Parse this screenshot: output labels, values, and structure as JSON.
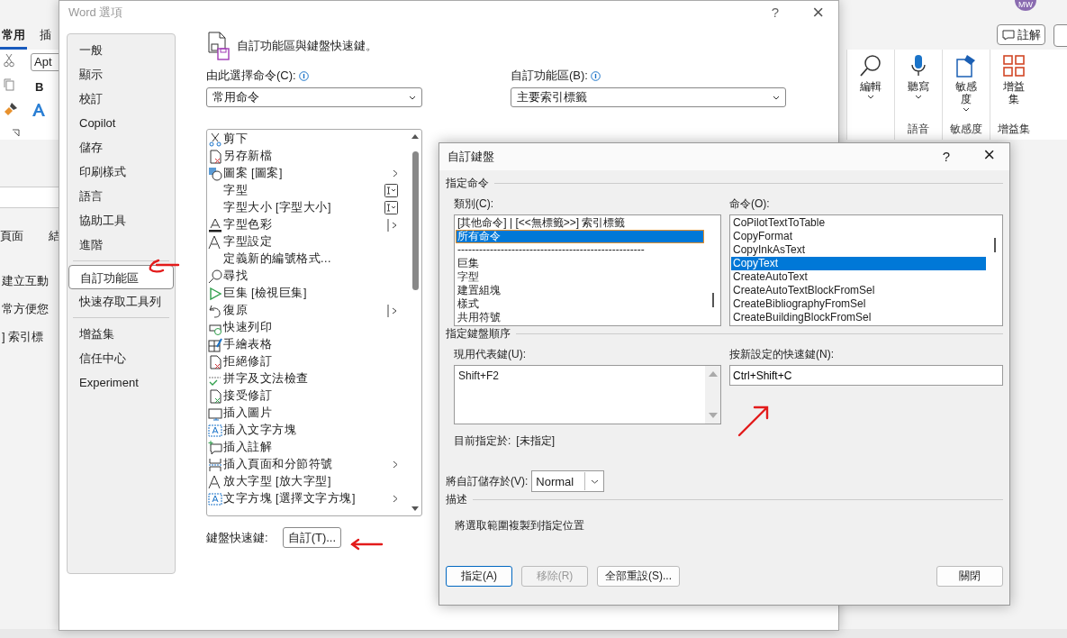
{
  "word": {
    "tabs": [
      {
        "label": "常用",
        "selected": true
      },
      {
        "label": "插",
        "selected": false
      }
    ],
    "font_field": {
      "value": "Apt"
    },
    "bold": "B",
    "ribbon_groups": [
      {
        "buttons": [
          {
            "label": "編輯",
            "dropdown": true
          }
        ]
      },
      {
        "title": "語音",
        "buttons": [
          {
            "label": "聽寫",
            "dropdown": true
          }
        ]
      },
      {
        "title": "敏感度",
        "buttons": [
          {
            "label": "敏感度",
            "dropdown": true
          }
        ]
      },
      {
        "title": "增益集",
        "buttons": [
          {
            "label": "增益集",
            "dropdown": false
          }
        ]
      }
    ],
    "comment_button": "註解",
    "avatar": "MW",
    "doc_tabs": [
      "頁面",
      "結"
    ],
    "doc_lines": [
      "建立互動",
      "常方便您",
      "] 索引標"
    ]
  },
  "options": {
    "title": "Word 選項",
    "help": "?",
    "close": "×",
    "nav_groups": [
      [
        {
          "label": "一般",
          "selected": false
        },
        {
          "label": "顯示",
          "selected": false
        },
        {
          "label": "校訂",
          "selected": false
        },
        {
          "label": "Copilot",
          "selected": false
        },
        {
          "label": "儲存",
          "selected": false
        },
        {
          "label": "印刷樣式",
          "selected": false
        },
        {
          "label": "語言",
          "selected": false
        },
        {
          "label": "協助工具",
          "selected": false
        },
        {
          "label": "進階",
          "selected": false
        }
      ],
      [
        {
          "label": "自訂功能區",
          "selected": true
        },
        {
          "label": "快速存取工具列",
          "selected": false
        }
      ],
      [
        {
          "label": "增益集",
          "selected": false
        },
        {
          "label": "信任中心",
          "selected": false
        },
        {
          "label": "Experiment",
          "selected": false
        }
      ]
    ],
    "heading": "自訂功能區與鍵盤快速鍵。",
    "choose_label": "由此選擇命令(C):",
    "choose_value": "常用命令",
    "ribbon_label": "自訂功能區(B):",
    "ribbon_value": "主要索引標籤",
    "commands": [
      {
        "label": "剪下",
        "icon": true,
        "kind": "none"
      },
      {
        "label": "另存新檔",
        "icon": true,
        "kind": "none"
      },
      {
        "label": "圖案 [圖案]",
        "icon": true,
        "kind": "arrow"
      },
      {
        "label": "字型",
        "icon": false,
        "kind": "field"
      },
      {
        "label": "字型大小 [字型大小]",
        "icon": false,
        "kind": "field"
      },
      {
        "label": "字型色彩",
        "icon": true,
        "kind": "split"
      },
      {
        "label": "字型設定",
        "icon": true,
        "kind": "none"
      },
      {
        "label": "定義新的編號格式...",
        "icon": false,
        "kind": "none"
      },
      {
        "label": "尋找",
        "icon": true,
        "kind": "none"
      },
      {
        "label": "巨集 [檢視巨集]",
        "icon": true,
        "kind": "none"
      },
      {
        "label": "復原",
        "icon": true,
        "kind": "split"
      },
      {
        "label": "快速列印",
        "icon": true,
        "kind": "none"
      },
      {
        "label": "手繪表格",
        "icon": true,
        "kind": "none"
      },
      {
        "label": "拒絕修訂",
        "icon": true,
        "kind": "none"
      },
      {
        "label": "拼字及文法檢查",
        "icon": true,
        "kind": "none"
      },
      {
        "label": "接受修訂",
        "icon": true,
        "kind": "none"
      },
      {
        "label": "插入圖片",
        "icon": true,
        "kind": "none"
      },
      {
        "label": "插入文字方塊",
        "icon": true,
        "kind": "none"
      },
      {
        "label": "插入註解",
        "icon": true,
        "kind": "none"
      },
      {
        "label": "插入頁面和分節符號",
        "icon": true,
        "kind": "arrow"
      },
      {
        "label": "放大字型 [放大字型]",
        "icon": true,
        "kind": "none"
      },
      {
        "label": "文字方塊 [選擇文字方塊]",
        "icon": true,
        "kind": "arrow"
      }
    ],
    "shortcut_label": "鍵盤快速鍵:",
    "shortcut_button": "自訂(T)..."
  },
  "keyboard": {
    "title": "自訂鍵盤",
    "help": "?",
    "close": "×",
    "section_assign": "指定命令",
    "categories_label": "類別(C):",
    "categories": [
      {
        "label": "[其他命令] | [<<無標籤>>] 索引標籤",
        "selected": false
      },
      {
        "label": "所有命令",
        "selected": true
      },
      {
        "label": "----------------------------------------------------",
        "selected": false
      },
      {
        "label": "巨集",
        "selected": false
      },
      {
        "label": "字型",
        "selected": false
      },
      {
        "label": "建置組塊",
        "selected": false
      },
      {
        "label": "樣式",
        "selected": false
      },
      {
        "label": "共用符號",
        "selected": false
      }
    ],
    "commands_label": "命令(O):",
    "commands": [
      {
        "label": "CoPilotTextToTable",
        "selected": false
      },
      {
        "label": "CopyFormat",
        "selected": false
      },
      {
        "label": "CopyInkAsText",
        "selected": false
      },
      {
        "label": "CopyText",
        "selected": true
      },
      {
        "label": "CreateAutoText",
        "selected": false
      },
      {
        "label": "CreateAutoTextBlockFromSel",
        "selected": false
      },
      {
        "label": "CreateBibliographyFromSel",
        "selected": false
      },
      {
        "label": "CreateBuildingBlockFromSel",
        "selected": false
      }
    ],
    "section_keys": "指定鍵盤順序",
    "current_label": "現用代表鍵(U):",
    "current_keys": [
      "Shift+F2"
    ],
    "new_label": "按新設定的快速鍵(N):",
    "new_value": "Ctrl+Shift+C",
    "assigned_label": "目前指定於:",
    "assigned_value": "[未指定]",
    "save_label": "將自訂儲存於(V):",
    "save_value": "Normal",
    "section_desc": "描述",
    "description": "將選取範圍複製到指定位置",
    "buttons": [
      {
        "label": "指定(A)",
        "kind": "default"
      },
      {
        "label": "移除(R)",
        "kind": "disabled"
      },
      {
        "label": "全部重設(S)...",
        "kind": "normal"
      },
      {
        "label": "關閉",
        "kind": "close"
      }
    ]
  }
}
